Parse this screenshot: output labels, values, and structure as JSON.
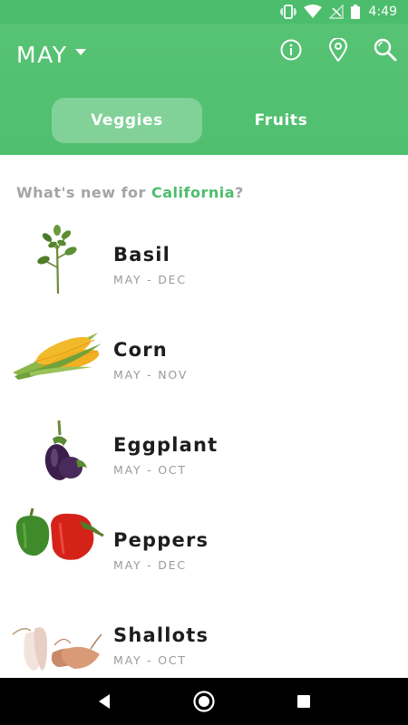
{
  "status_bar": {
    "time": "4:49",
    "icons": [
      "vibrate-icon",
      "wifi-icon",
      "no-signal-icon",
      "battery-icon"
    ]
  },
  "header": {
    "month": "MAY",
    "actions": [
      "info-icon",
      "location-pin-icon",
      "search-icon"
    ],
    "tabs": [
      {
        "label": "Veggies",
        "active": true
      },
      {
        "label": "Fruits",
        "active": false
      }
    ]
  },
  "prompt": {
    "prefix": "What's new for ",
    "location": "California",
    "suffix": "?"
  },
  "items": [
    {
      "name": "Basil",
      "season": "MAY - DEC",
      "icon": "basil-image"
    },
    {
      "name": "Corn",
      "season": "MAY - NOV",
      "icon": "corn-image"
    },
    {
      "name": "Eggplant",
      "season": "MAY - OCT",
      "icon": "eggplant-image"
    },
    {
      "name": "Peppers",
      "season": "MAY - DEC",
      "icon": "peppers-image"
    },
    {
      "name": "Shallots",
      "season": "MAY - OCT",
      "icon": "shallots-image"
    }
  ],
  "nav": [
    "back-icon",
    "home-icon",
    "recents-icon"
  ],
  "colors": {
    "brand": "#4cbd6c",
    "text": "#1d1d1d",
    "muted": "#9a9a9a"
  }
}
